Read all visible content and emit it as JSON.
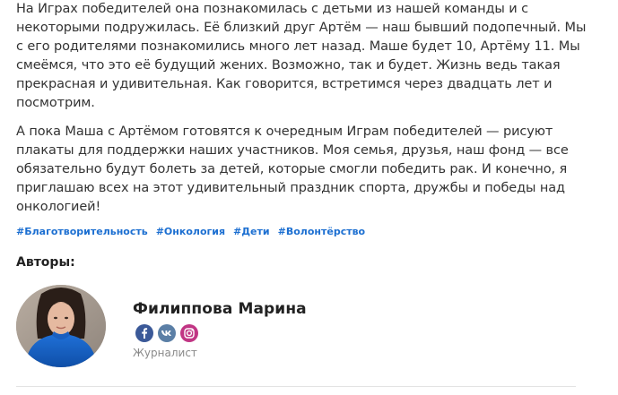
{
  "article": {
    "paragraph_1_lines": [
      "На Играх победителей она познакомилась с детьми из нашей команды и с",
      "некоторыми подружилась. Её близкий друг Артём — наш бывший подопечный. Мы",
      "с его родителями познакомились много лет назад. Маше будет 10, Артёму 11. Мы",
      "смеёмся, что это её будущий жених. Возможно, так и будет. Жизнь ведь такая",
      "прекрасная и удивительная. Как говорится, встретимся через двадцать лет и",
      "посмотрим."
    ],
    "paragraph_2_lines": [
      "А пока Маша с Артёмом готовятся к очередным Играм победителей — рисуют",
      "плакаты для поддержки наших участников. Моя семья, друзья, наш фонд — все",
      "обязательно будут болеть за детей, которые смогли победить рак. И конечно, я",
      "приглашаю всех на этот удивительный праздник спорта, дружбы и победы над",
      "онкологией!"
    ]
  },
  "tags": [
    "#Благотворительность",
    "#Онкология",
    "#Дети",
    "#Волонтёрство"
  ],
  "authors": {
    "heading": "Авторы:",
    "items": [
      {
        "name": "Филиппова Марина",
        "role": "Журналист",
        "socials": [
          "facebook-icon",
          "vk-icon",
          "instagram-icon"
        ]
      }
    ]
  },
  "colors": {
    "text": "#333333",
    "tag": "#1c6fd1",
    "role": "#8a8a8a",
    "facebook": "#3b5998",
    "vk": "#5b7fa6",
    "instagram": "#c13584"
  }
}
